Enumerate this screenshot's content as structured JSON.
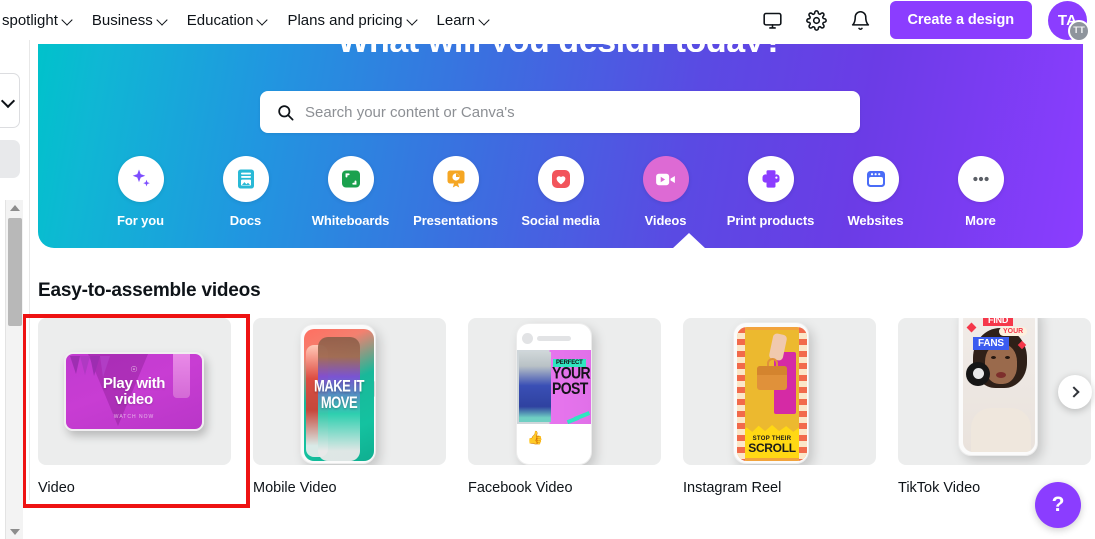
{
  "topnav": {
    "menu_items": [
      {
        "label": "spotlight",
        "icon": "chevron-down-icon"
      },
      {
        "label": "Business",
        "icon": "chevron-down-icon"
      },
      {
        "label": "Education",
        "icon": "chevron-down-icon"
      },
      {
        "label": "Plans and pricing",
        "icon": "chevron-down-icon"
      },
      {
        "label": "Learn",
        "icon": "chevron-down-icon"
      }
    ],
    "actions": [
      {
        "name": "display-icon",
        "icon": "monitor-icon"
      },
      {
        "name": "settings-icon",
        "icon": "gear-icon"
      },
      {
        "name": "notifications-icon",
        "icon": "bell-icon"
      }
    ],
    "create_button": "Create a design",
    "avatar": {
      "initials": "TA",
      "badge": "TT",
      "color": "#8b3dff",
      "badge_color": "#8e949c"
    }
  },
  "hero": {
    "title": "What will you design today?",
    "gradient_from": "#00c2cb",
    "gradient_to": "#8b3dff",
    "search": {
      "placeholder": "Search your content or Canva's",
      "value": "",
      "icon": "search-icon"
    },
    "categories": [
      {
        "label": "For you",
        "icon": "sparkle-icon",
        "color": "#7d4dff",
        "selected": false
      },
      {
        "label": "Docs",
        "icon": "document-icon",
        "color": "#29b9d6",
        "selected": false
      },
      {
        "label": "Whiteboards",
        "icon": "whiteboard-icon",
        "color": "#1ba14e",
        "selected": false
      },
      {
        "label": "Presentations",
        "icon": "presentation-icon",
        "color": "#f5a623",
        "selected": false
      },
      {
        "label": "Social media",
        "icon": "heart-icon",
        "color": "#f2545b",
        "selected": false
      },
      {
        "label": "Videos",
        "icon": "video-camera-icon",
        "color": "#ffffff",
        "selected": true
      },
      {
        "label": "Print products",
        "icon": "printer-icon",
        "color": "#8b3dff",
        "selected": false
      },
      {
        "label": "Websites",
        "icon": "browser-icon",
        "color": "#4a6cf7",
        "selected": false
      },
      {
        "label": "More",
        "icon": "ellipsis-icon",
        "color": "#5b5f66",
        "selected": false
      }
    ]
  },
  "section": {
    "title": "Easy-to-assemble videos",
    "cards": [
      {
        "label": "Video",
        "thumb_text": [
          "Play with",
          "video"
        ],
        "selected": true
      },
      {
        "label": "Mobile Video",
        "thumb_text": [
          "MAKE IT",
          "MOVE"
        ],
        "selected": false
      },
      {
        "label": "Facebook Video",
        "thumb_text": [
          "PERFECT",
          "YOUR",
          "POST"
        ],
        "selected": false
      },
      {
        "label": "Instagram Reel",
        "thumb_text": [
          "STOP THEIR",
          "SCROLL"
        ],
        "selected": false
      },
      {
        "label": "TikTok Video",
        "thumb_text": [
          "FIND",
          "YOUR",
          "FANS"
        ],
        "selected": false
      }
    ],
    "next_arrow_icon": "chevron-right-icon",
    "selection_color": "#ee1212"
  },
  "help": {
    "label": "?",
    "color": "#8b3dff"
  }
}
